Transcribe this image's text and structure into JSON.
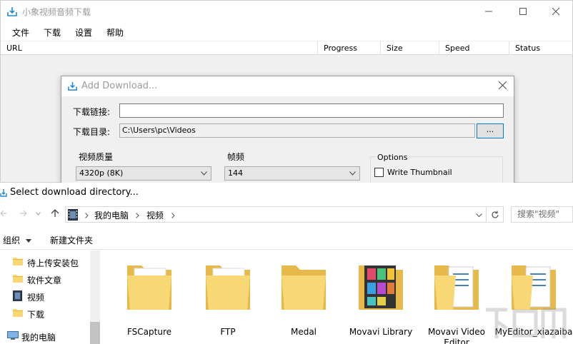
{
  "app": {
    "title": "小象视频音频下载",
    "menu": [
      "文件",
      "下载",
      "设置",
      "帮助"
    ],
    "columns": [
      "URL",
      "Progress",
      "Size",
      "Speed",
      "Status"
    ]
  },
  "dialog": {
    "title": "Add Download...",
    "url_label": "下载链接:",
    "url_value": "",
    "dir_label": "下载目录:",
    "dir_value": "C:\\Users\\pc\\Videos",
    "browse_label": "...",
    "quality_label": "视频质量",
    "quality_value": "4320p (8K)",
    "fps_label": "帧频",
    "fps_value": "144",
    "options_label": "Options",
    "write_thumbnail": "Write Thumbnail",
    "write_thumbnail_checked": false
  },
  "folder_dialog": {
    "title": "Select download directory...",
    "breadcrumb": [
      "我的电脑",
      "视频"
    ],
    "search_placeholder": "搜索\"视频\"",
    "organize": "组织",
    "new_folder": "新建文件夹",
    "nav_items": [
      {
        "label": "待上传安装包",
        "icon": "folder-icon"
      },
      {
        "label": "软件文章",
        "icon": "folder-icon"
      },
      {
        "label": "视频",
        "icon": "video-library-icon"
      },
      {
        "label": "下载",
        "icon": "folder-icon"
      },
      {
        "label": "我的电脑",
        "icon": "computer-icon"
      }
    ],
    "folders": [
      "FSCapture",
      "FTP",
      "Medal",
      "Movavi Library",
      "Movavi Video Editor",
      "MyEditor_xiazaiba"
    ]
  },
  "colors": {
    "accent": "#0078d7",
    "folder": "#f8d775",
    "folder_dark": "#e6b94a"
  }
}
